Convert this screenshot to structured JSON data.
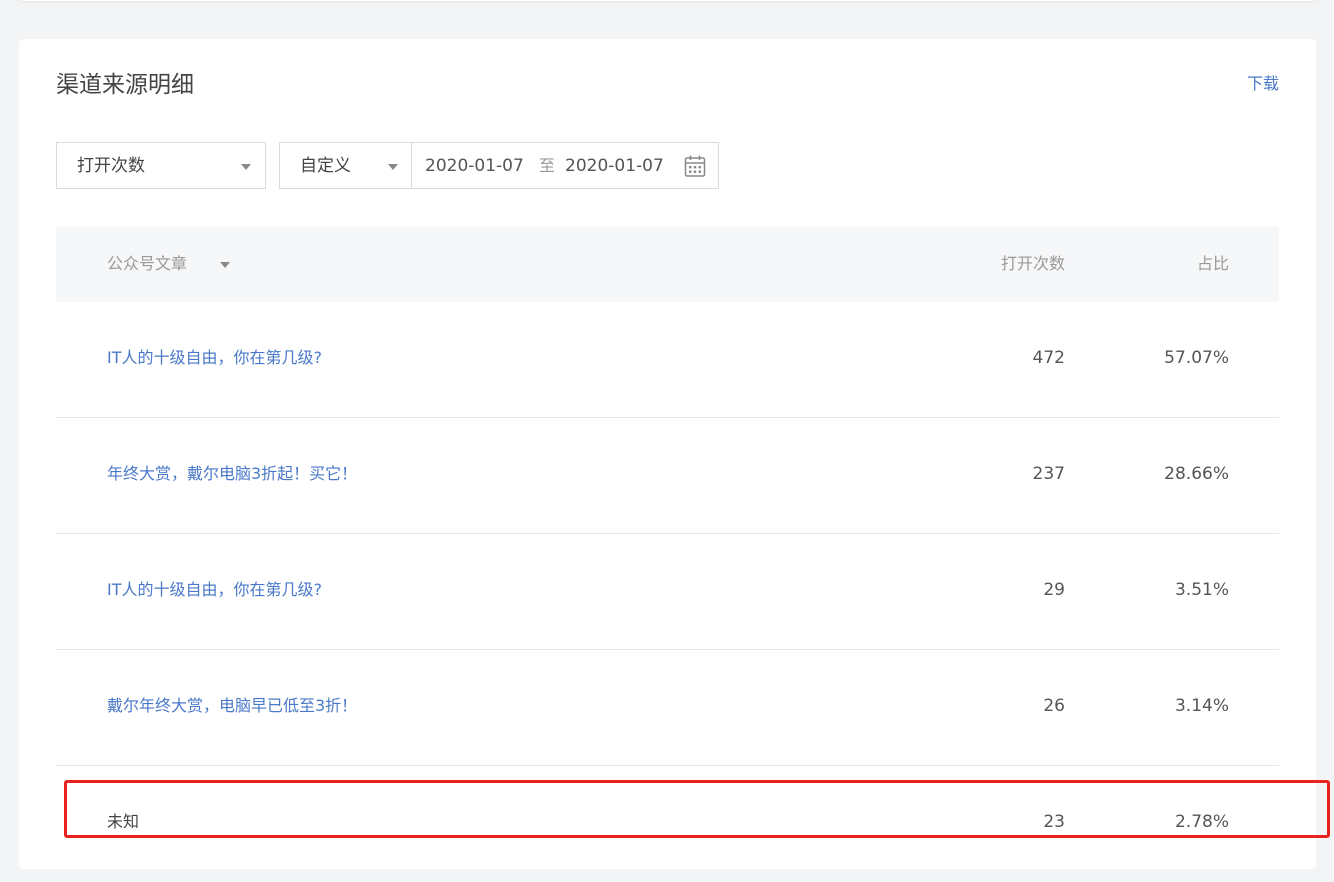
{
  "panel": {
    "title": "渠道来源明细",
    "download_label": "下载"
  },
  "filters": {
    "metric": "打开次数",
    "range_type": "自定义",
    "date_start": "2020-01-07",
    "date_separator": "至",
    "date_end": "2020-01-07"
  },
  "table": {
    "headers": {
      "article": "公众号文章",
      "opens": "打开次数",
      "ratio": "占比"
    },
    "rows": [
      {
        "name": "IT人的十级自由，你在第几级?",
        "opens": "472",
        "ratio": "57.07%"
      },
      {
        "name": "年终大赏，戴尔电脑3折起！买它！",
        "opens": "237",
        "ratio": "28.66%"
      },
      {
        "name": "IT人的十级自由，你在第几级?",
        "opens": "29",
        "ratio": "3.51%"
      },
      {
        "name": "戴尔年终大赏，电脑早已低至3折！",
        "opens": "26",
        "ratio": "3.14%"
      },
      {
        "name": "未知",
        "opens": "23",
        "ratio": "2.78%"
      }
    ]
  },
  "colors": {
    "link": "#4a79c9",
    "highlight_border": "#e8231f"
  }
}
